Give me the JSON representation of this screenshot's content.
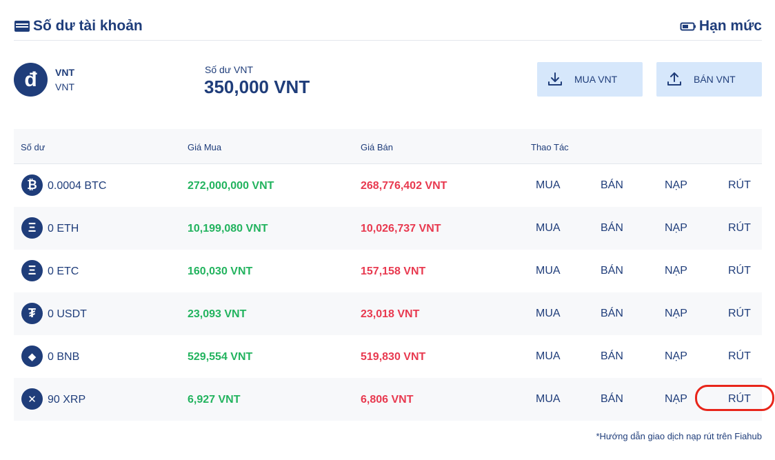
{
  "header": {
    "title": "Số dư tài khoản",
    "limit_label": "Hạn mức",
    "wallet_icon": "wallet-icon",
    "battery_icon": "battery-icon"
  },
  "account": {
    "logo_symbol": "đ",
    "code": "VNT",
    "name": "VNT",
    "balance_label": "Số dư VNT",
    "balance_value": "350,000 VNT",
    "buy_button": "MUA VNT",
    "sell_button": "BÁN VNT",
    "buy_icon": "download-icon",
    "sell_icon": "upload-icon"
  },
  "table": {
    "headers": [
      "Số dư",
      "Giá Mua",
      "Giá Bán",
      "Thao Tác"
    ],
    "actions": {
      "buy": "MUA",
      "sell": "BÁN",
      "deposit": "NẠP",
      "withdraw": "RÚT"
    },
    "rows": [
      {
        "icon": "bitcoin-icon",
        "symbol": "₿",
        "balance": "0.0004 BTC",
        "buy_price": "272,000,000 VNT",
        "sell_price": "268,776,402 VNT"
      },
      {
        "icon": "ethereum-icon",
        "symbol": "Ξ",
        "balance": "0 ETH",
        "buy_price": "10,199,080 VNT",
        "sell_price": "10,026,737 VNT"
      },
      {
        "icon": "ethereum-classic-icon",
        "symbol": "Ξ",
        "balance": "0 ETC",
        "buy_price": "160,030 VNT",
        "sell_price": "157,158 VNT"
      },
      {
        "icon": "tether-icon",
        "symbol": "₮",
        "balance": "0 USDT",
        "buy_price": "23,093 VNT",
        "sell_price": "23,018 VNT"
      },
      {
        "icon": "binance-coin-icon",
        "symbol": "◆",
        "balance": "0 BNB",
        "buy_price": "529,554 VNT",
        "sell_price": "519,830 VNT"
      },
      {
        "icon": "ripple-icon",
        "symbol": "✕",
        "balance": "90 XRP",
        "buy_price": "6,927 VNT",
        "sell_price": "6,806 VNT"
      }
    ]
  },
  "note": "*Hướng dẫn giao dịch nạp rút trên Fiahub",
  "colors": {
    "primary": "#1f3d7a",
    "buy": "#22b35e",
    "sell": "#e8394f",
    "button_bg": "#d6e7fb",
    "highlight": "#e8251a"
  }
}
